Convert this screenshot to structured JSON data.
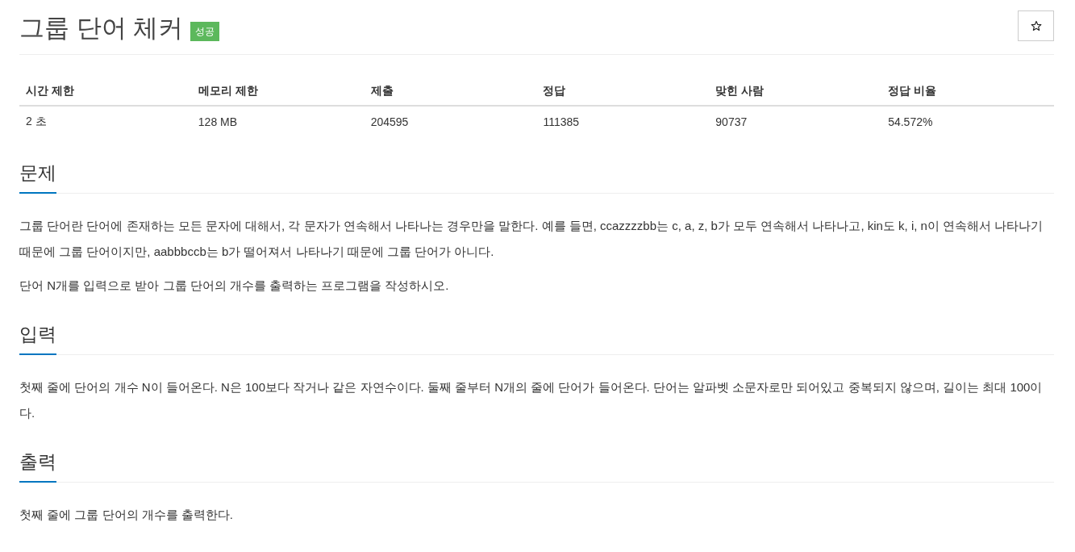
{
  "title": "그룹 단어 체커",
  "badge": "성공",
  "limits_table": {
    "columns": [
      "시간 제한",
      "메모리 제한",
      "제출",
      "정답",
      "맞힌 사람",
      "정답 비율"
    ],
    "rows": [
      [
        "2 초",
        "128 MB",
        "204595",
        "111385",
        "90737",
        "54.572%"
      ]
    ]
  },
  "sections": [
    {
      "heading": "문제",
      "paragraphs": [
        "그룹 단어란 단어에 존재하는 모든 문자에 대해서, 각 문자가 연속해서 나타나는 경우만을 말한다. 예를 들면, ccazzzzbb는 c, a, z, b가 모두 연속해서 나타나고, kin도 k, i, n이 연속해서 나타나기 때문에 그룹 단어이지만, aabbbccb는 b가 떨어져서 나타나기 때문에 그룹 단어가 아니다.",
        "단어 N개를 입력으로 받아 그룹 단어의 개수를 출력하는 프로그램을 작성하시오."
      ]
    },
    {
      "heading": "입력",
      "paragraphs": [
        "첫째 줄에 단어의 개수 N이 들어온다. N은 100보다 작거나 같은 자연수이다. 둘째 줄부터 N개의 줄에 단어가 들어온다. 단어는 알파벳 소문자로만 되어있고 중복되지 않으며, 길이는 최대 100이다."
      ]
    },
    {
      "heading": "출력",
      "paragraphs": [
        "첫째 줄에 그룹 단어의 개수를 출력한다."
      ]
    }
  ]
}
